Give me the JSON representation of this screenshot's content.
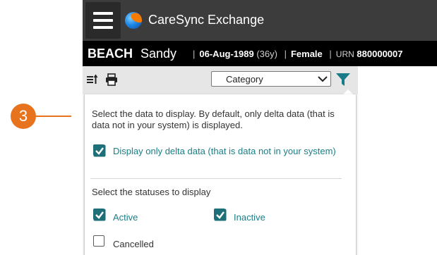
{
  "header": {
    "app_title": "CareSync Exchange"
  },
  "patient": {
    "last_name": "BEACH",
    "first_name": "Sandy",
    "dob": "06-Aug-1989",
    "age": "(36y)",
    "gender": "Female",
    "urn_label": "URN",
    "urn_value": "880000007"
  },
  "toolbar": {
    "category_value": "Category"
  },
  "panel": {
    "intro_text": "Select the data to display. By default, only delta data (that is data not in your system) is displayed.",
    "delta_label": "Display only delta data (that is data not in your system)",
    "delta_checked": true,
    "status_heading": "Select the statuses to display",
    "statuses": [
      {
        "label": "Active",
        "checked": true
      },
      {
        "label": "Inactive",
        "checked": true
      },
      {
        "label": "Cancelled",
        "checked": false
      }
    ]
  },
  "callout": {
    "number": "3"
  },
  "colors": {
    "teal": "#1a7f86",
    "callout": "#e8731f",
    "topbar": "#3c3c3c"
  },
  "icons": [
    "menu-icon",
    "app-logo-icon",
    "sort-icon",
    "print-icon",
    "chevron-down-icon",
    "filter-icon",
    "checkbox-checked-icon"
  ]
}
